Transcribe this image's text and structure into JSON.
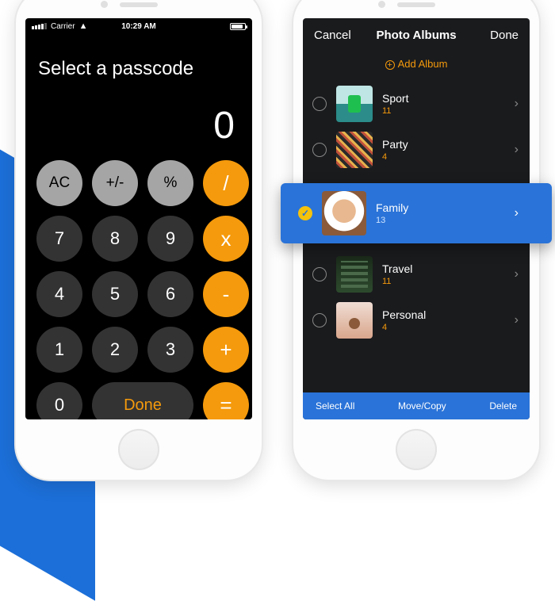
{
  "statusbar": {
    "carrier": "Carrier",
    "time": "10:29 AM"
  },
  "calc": {
    "prompt": "Select a passcode",
    "display": "0",
    "keys": {
      "ac": "AC",
      "pm": "+/-",
      "pc": "%",
      "div": "/",
      "k7": "7",
      "k8": "8",
      "k9": "9",
      "mul": "x",
      "k4": "4",
      "k5": "5",
      "k6": "6",
      "sub": "-",
      "k1": "1",
      "k2": "2",
      "k3": "3",
      "add": "+",
      "k0": "0",
      "done": "Done",
      "eq": "="
    }
  },
  "albums_screen": {
    "nav": {
      "cancel": "Cancel",
      "title": "Photo Albums",
      "done": "Done"
    },
    "add_label": "Add Album",
    "albums": [
      {
        "name": "Sport",
        "count": "11",
        "selected": false
      },
      {
        "name": "Party",
        "count": "4",
        "selected": false
      },
      {
        "name": "Family",
        "count": "13",
        "selected": true
      },
      {
        "name": "Travel",
        "count": "11",
        "selected": false
      },
      {
        "name": "Personal",
        "count": "4",
        "selected": false
      }
    ],
    "bottom": {
      "select_all": "Select All",
      "move_copy": "Move/Copy",
      "delete": "Delete"
    }
  }
}
